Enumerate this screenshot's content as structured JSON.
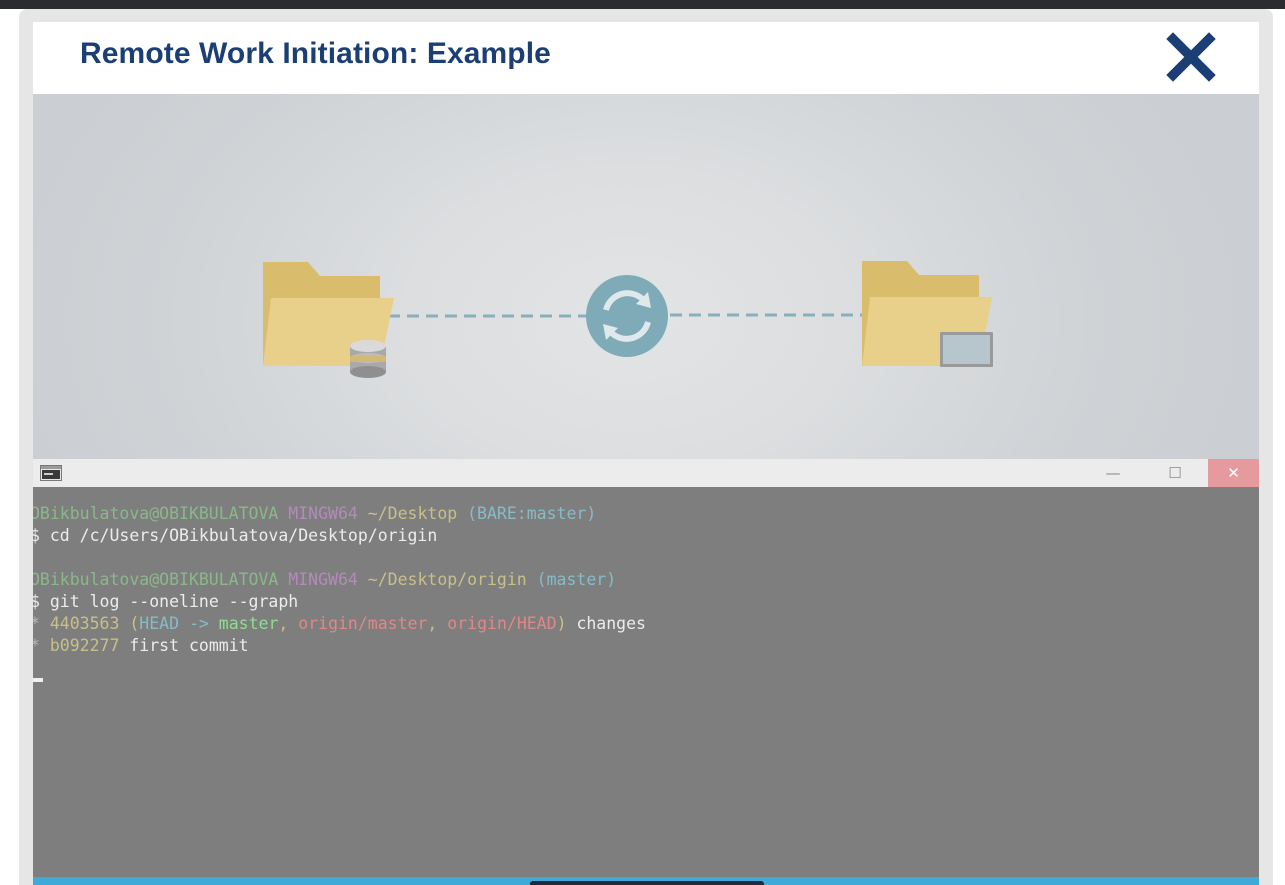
{
  "modal": {
    "title": "Remote Work Initiation: Example"
  },
  "diagram": {
    "left_folder_icon": "folder-database-icon",
    "center_icon": "sync-icon",
    "right_folder_icon": "folder-computer-icon"
  },
  "console": {
    "app_icon_text": "C:\\",
    "minimize_glyph": "—",
    "maximize_glyph": "☐",
    "close_glyph": "✕",
    "lines": {
      "l1": {
        "user": "OBikbulatova@OBIKBULATOVA",
        "env": "MINGW64",
        "path": "~/Desktop",
        "branch": "(BARE:master)"
      },
      "l2": {
        "prompt": "$",
        "cmd": "cd /c/Users/OBikbulatova/Desktop/origin"
      },
      "l3": {
        "user": "OBikbulatova@OBIKBULATOVA",
        "env": "MINGW64",
        "path": "~/Desktop/origin",
        "branch": "(master)"
      },
      "l4": {
        "prompt": "$",
        "cmd": "git log --oneline --graph"
      },
      "l5": {
        "star": "*",
        "hash": "4403563",
        "open": "(",
        "head": "HEAD ->",
        "master": "master",
        "comma1": ",",
        "origin_master": "origin/master",
        "comma2": ",",
        "origin_head": "origin/HEAD",
        "close": ")",
        "msg": "changes"
      },
      "l6": {
        "star": "*",
        "hash": "b092277",
        "msg": "first commit"
      }
    }
  },
  "colors": {
    "title": "#1b3f75",
    "accent_bar": "#3fa9d8",
    "console_bg": "#7e7e7e",
    "folder": "#e3c978",
    "sync_circle": "#7eabb7"
  }
}
